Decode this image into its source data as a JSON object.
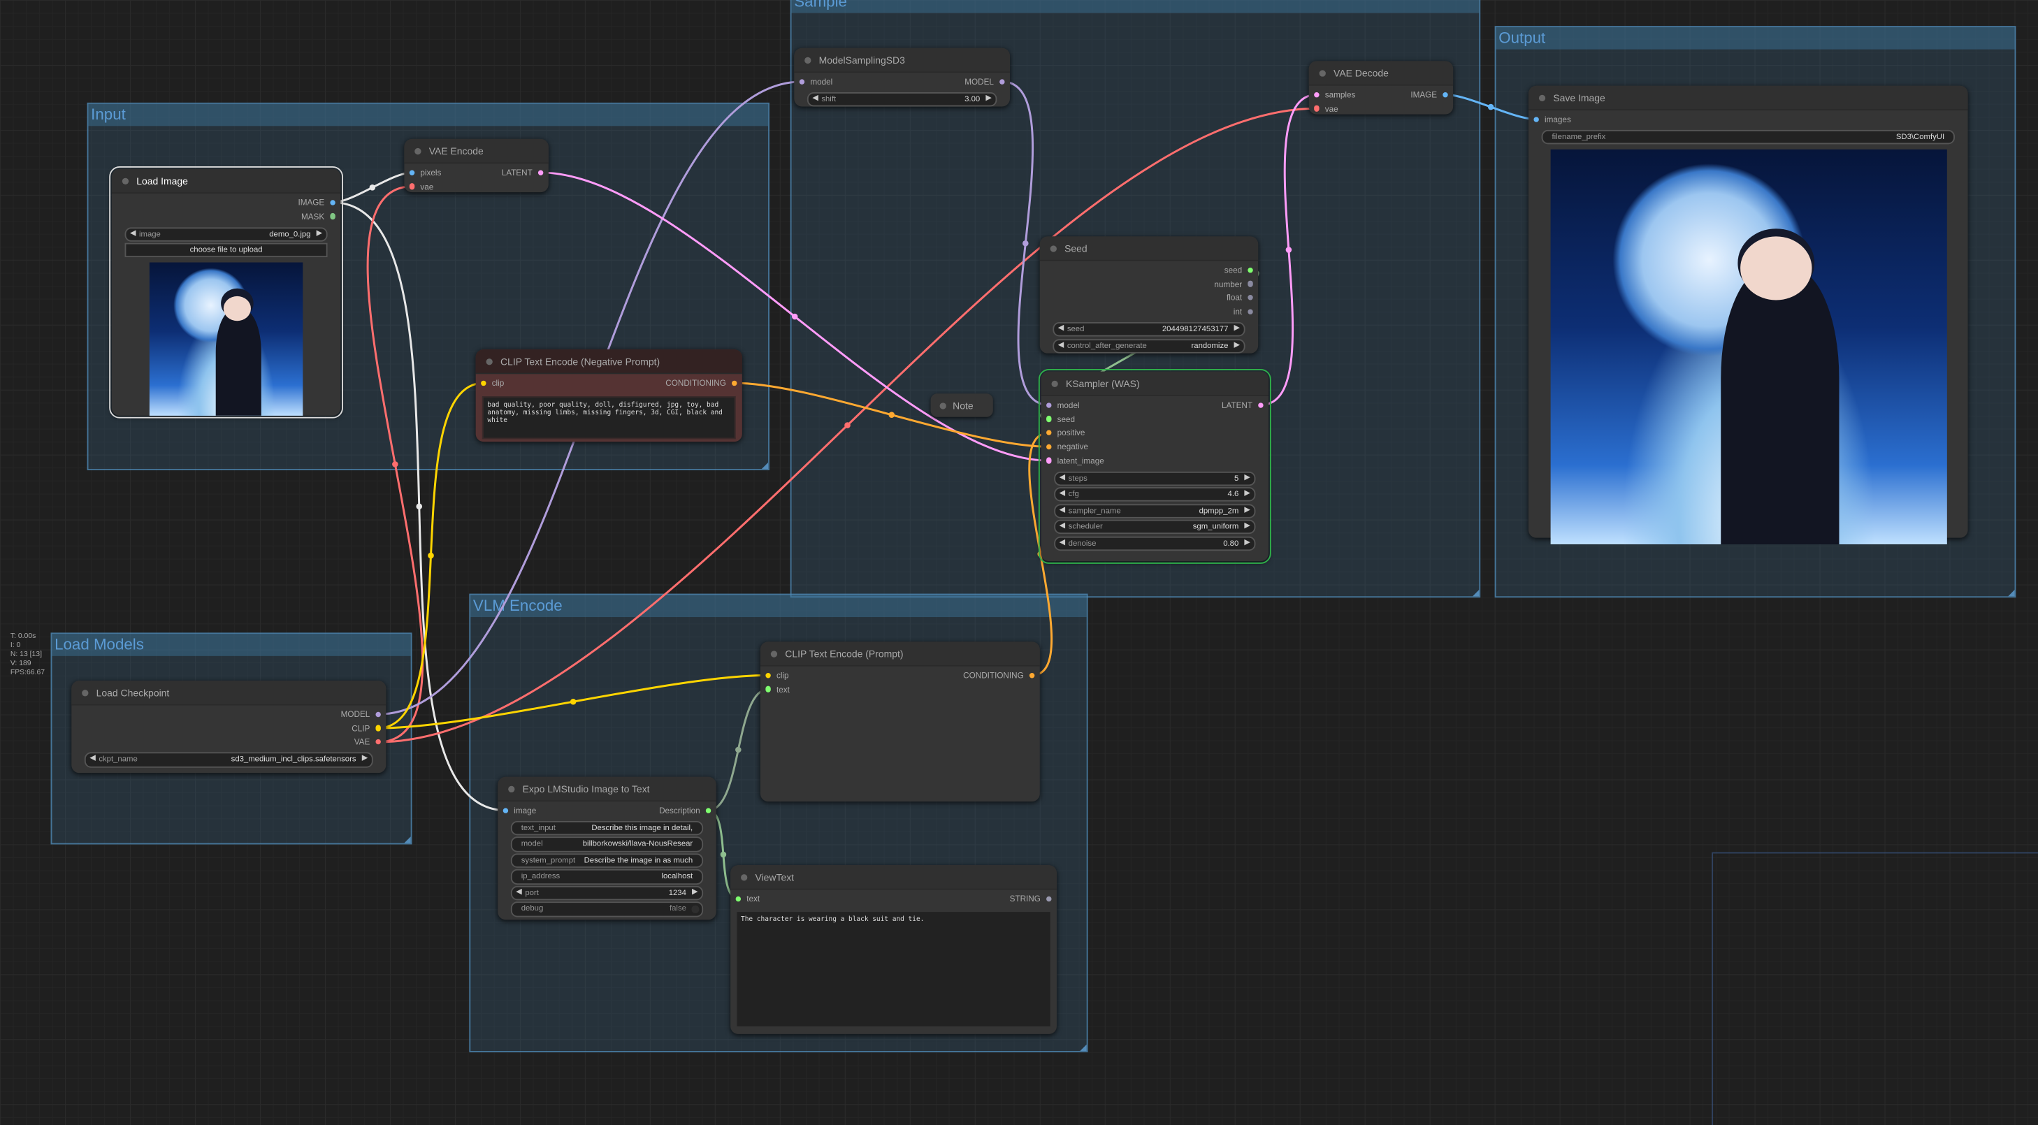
{
  "stats": {
    "time": "T: 0.00s",
    "i": "I: 0",
    "n": "N: 13 [13]",
    "v": "V: 189",
    "fps": "FPS:66.67"
  },
  "slot_colors": {
    "MODEL": "#b09ddb",
    "CLIP": "#ffd500",
    "VAE": "#ff6e6e",
    "LATENT": "#ff9cf9",
    "IMAGE": "#64b5f6",
    "MASK": "#81c784",
    "CONDITIONING": "#ffa931",
    "STRING": "#9a9ab0",
    "INT": "#7fff6f",
    "NUMBER": "#8a8aa0"
  },
  "groups": [
    {
      "id": "sample",
      "title": "Sample"
    },
    {
      "id": "output",
      "title": "Output"
    },
    {
      "id": "input",
      "title": "Input"
    },
    {
      "id": "vlm",
      "title": "VLM Encode"
    },
    {
      "id": "models",
      "title": "Load Models"
    }
  ],
  "nodes": [
    {
      "id": "load_image",
      "title": "Load Image",
      "inputs": [],
      "outputs": [
        {
          "name": "IMAGE",
          "type": "IMAGE"
        },
        {
          "name": "MASK",
          "type": "MASK"
        }
      ],
      "widgets": [
        {
          "type": "combo",
          "label": "image",
          "value": "demo_0.jpg"
        },
        {
          "type": "button",
          "label": "choose file to upload"
        }
      ],
      "preview": true
    },
    {
      "id": "vae_encode",
      "title": "VAE Encode",
      "inputs": [
        {
          "name": "pixels",
          "type": "IMAGE"
        },
        {
          "name": "vae",
          "type": "VAE"
        }
      ],
      "outputs": [
        {
          "name": "LATENT",
          "type": "LATENT"
        }
      ],
      "widgets": []
    },
    {
      "id": "model_sampling",
      "title": "ModelSamplingSD3",
      "inputs": [
        {
          "name": "model",
          "type": "MODEL"
        }
      ],
      "outputs": [
        {
          "name": "MODEL",
          "type": "MODEL"
        }
      ],
      "widgets": [
        {
          "type": "combo",
          "label": "shift",
          "value": "3.00"
        }
      ]
    },
    {
      "id": "vae_decode",
      "title": "VAE Decode",
      "inputs": [
        {
          "name": "samples",
          "type": "LATENT"
        },
        {
          "name": "vae",
          "type": "VAE"
        }
      ],
      "outputs": [
        {
          "name": "IMAGE",
          "type": "IMAGE"
        }
      ],
      "widgets": []
    },
    {
      "id": "save_image",
      "title": "Save Image",
      "inputs": [
        {
          "name": "images",
          "type": "IMAGE"
        }
      ],
      "outputs": [],
      "widgets": [
        {
          "type": "text",
          "label": "filename_prefix",
          "value": "SD3\\ComfyUI"
        }
      ],
      "preview": true
    },
    {
      "id": "seed",
      "title": "Seed",
      "inputs": [],
      "outputs": [
        {
          "name": "seed",
          "type": "INT"
        },
        {
          "name": "number",
          "type": "NUMBER"
        },
        {
          "name": "float",
          "type": "NUMBER"
        },
        {
          "name": "int",
          "type": "NUMBER"
        }
      ],
      "widgets": [
        {
          "type": "combo",
          "label": "seed",
          "value": "204498127453177"
        },
        {
          "type": "combo",
          "label": "control_after_generate",
          "value": "randomize"
        }
      ]
    },
    {
      "id": "ksampler",
      "title": "KSampler (WAS)",
      "inputs": [
        {
          "name": "model",
          "type": "MODEL"
        },
        {
          "name": "seed",
          "type": "INT"
        },
        {
          "name": "positive",
          "type": "CONDITIONING"
        },
        {
          "name": "negative",
          "type": "CONDITIONING"
        },
        {
          "name": "latent_image",
          "type": "LATENT"
        }
      ],
      "outputs": [
        {
          "name": "LATENT",
          "type": "LATENT"
        }
      ],
      "widgets": [
        {
          "type": "combo",
          "label": "steps",
          "value": "5"
        },
        {
          "type": "combo",
          "label": "cfg",
          "value": "4.6"
        },
        {
          "type": "combo",
          "label": "sampler_name",
          "value": "dpmpp_2m"
        },
        {
          "type": "combo",
          "label": "scheduler",
          "value": "sgm_uniform"
        },
        {
          "type": "combo",
          "label": "denoise",
          "value": "0.80"
        }
      ]
    },
    {
      "id": "clip_neg",
      "title": "CLIP Text Encode (Negative Prompt)",
      "inputs": [
        {
          "name": "clip",
          "type": "CLIP"
        }
      ],
      "outputs": [
        {
          "name": "CONDITIONING",
          "type": "CONDITIONING"
        }
      ],
      "widgets": [],
      "textarea": "bad quality, poor quality, doll, disfigured, jpg, toy, bad anatomy, missing limbs, missing fingers, 3d, CGI, black and white"
    },
    {
      "id": "clip_pos",
      "title": "CLIP Text Encode (Prompt)",
      "inputs": [
        {
          "name": "clip",
          "type": "CLIP"
        },
        {
          "name": "text",
          "type": "INT"
        }
      ],
      "outputs": [
        {
          "name": "CONDITIONING",
          "type": "CONDITIONING"
        }
      ],
      "widgets": []
    },
    {
      "id": "load_ckpt",
      "title": "Load Checkpoint",
      "inputs": [],
      "outputs": [
        {
          "name": "MODEL",
          "type": "MODEL"
        },
        {
          "name": "CLIP",
          "type": "CLIP"
        },
        {
          "name": "VAE",
          "type": "VAE"
        }
      ],
      "widgets": [
        {
          "type": "combo",
          "label": "ckpt_name",
          "value": "sd3_medium_incl_clips.safetensors"
        }
      ]
    },
    {
      "id": "expo",
      "title": "Expo LMStudio Image to Text",
      "inputs": [
        {
          "name": "image",
          "type": "IMAGE"
        }
      ],
      "outputs": [
        {
          "name": "Description",
          "type": "INT"
        }
      ],
      "widgets": [
        {
          "type": "text",
          "label": "text_input",
          "value": "Describe this image in detail,"
        },
        {
          "type": "text",
          "label": "model",
          "value": "billborkowski/llava-NousResear"
        },
        {
          "type": "text",
          "label": "system_prompt",
          "value": "Describe the image in as much"
        },
        {
          "type": "text",
          "label": "ip_address",
          "value": "localhost"
        },
        {
          "type": "combo",
          "label": "port",
          "value": "1234"
        },
        {
          "type": "toggle",
          "label": "debug",
          "value": "false"
        }
      ]
    },
    {
      "id": "view_text",
      "title": "ViewText",
      "inputs": [
        {
          "name": "text",
          "type": "INT"
        }
      ],
      "outputs": [
        {
          "name": "STRING",
          "type": "STRING"
        }
      ],
      "widgets": [],
      "textarea": "The character is wearing a black suit and tie."
    }
  ],
  "note": {
    "title": "Note"
  },
  "links": [
    {
      "from": "load_image:IMAGE",
      "to": "vae_encode:pixels",
      "color": "#e8e8e8"
    },
    {
      "from": "load_image:IMAGE",
      "to": "expo:image",
      "color": "#e8e8e8"
    },
    {
      "from": "load_ckpt:VAE",
      "to": "vae_encode:vae",
      "color": "#ff6e6e"
    },
    {
      "from": "load_ckpt:VAE",
      "to": "vae_decode:vae",
      "color": "#ff6e6e"
    },
    {
      "from": "load_ckpt:MODEL",
      "to": "model_sampling:model",
      "color": "#b09ddb"
    },
    {
      "from": "load_ckpt:CLIP",
      "to": "clip_neg:clip",
      "color": "#ffd500"
    },
    {
      "from": "load_ckpt:CLIP",
      "to": "clip_pos:clip",
      "color": "#ffd500"
    },
    {
      "from": "vae_encode:LATENT",
      "to": "ksampler:latent_image",
      "color": "#ff9cf9"
    },
    {
      "from": "model_sampling:MODEL",
      "to": "ksampler:model",
      "color": "#b09ddb"
    },
    {
      "from": "clip_neg:CONDITIONING",
      "to": "ksampler:negative",
      "color": "#ffa931"
    },
    {
      "from": "clip_pos:CONDITIONING",
      "to": "ksampler:positive",
      "color": "#ffa931"
    },
    {
      "from": "seed:seed",
      "to": "ksampler:seed",
      "color": "#8fbf8f"
    },
    {
      "from": "ksampler:LATENT",
      "to": "vae_decode:samples",
      "color": "#ff9cf9"
    },
    {
      "from": "vae_decode:IMAGE",
      "to": "save_image:images",
      "color": "#64b5f6"
    },
    {
      "from": "expo:Description",
      "to": "clip_pos:text",
      "color": "#8fa88f"
    },
    {
      "from": "expo:Description",
      "to": "view_text:text",
      "color": "#8fbf8f"
    }
  ]
}
